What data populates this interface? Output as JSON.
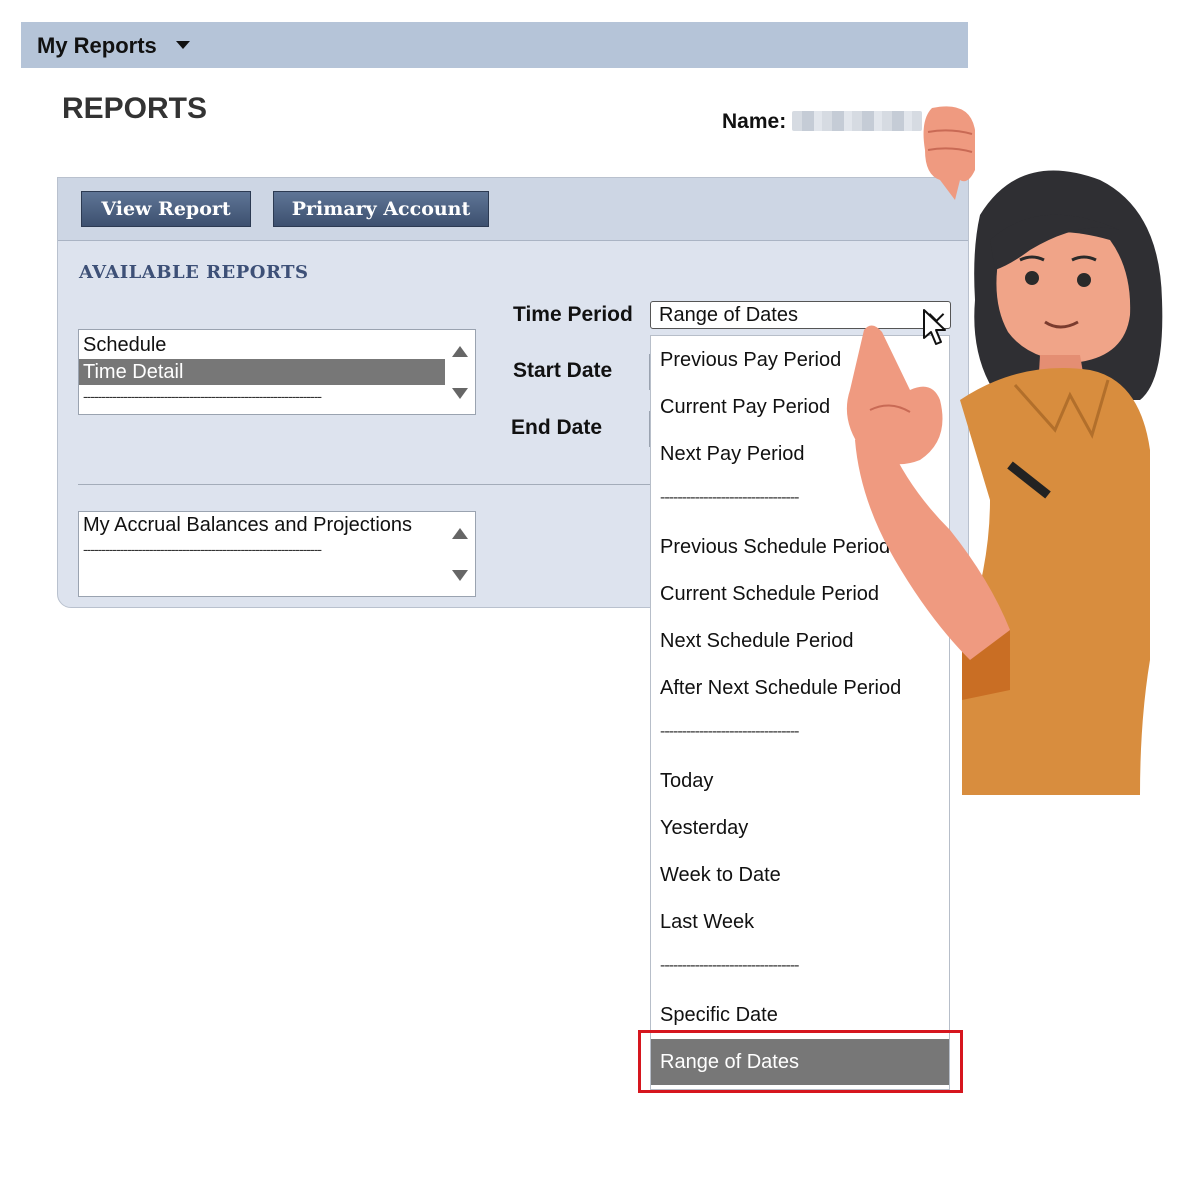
{
  "header": {
    "menu_title": "My Reports"
  },
  "page": {
    "title": "REPORTS",
    "name_label": "Name:"
  },
  "toolbar": {
    "view_report": "View Report",
    "primary_account": "Primary Account"
  },
  "reports": {
    "section_label": "AVAILABLE REPORTS",
    "list1": {
      "items": [
        "Schedule",
        "Time Detail"
      ],
      "selected": "Time Detail",
      "separator": "-----------------------------------------------------------------"
    },
    "list2": {
      "items": [
        "My Accrual Balances and Projections"
      ],
      "separator": "-----------------------------------------------------------------"
    }
  },
  "filters": {
    "time_period_label": "Time Period",
    "time_period_value": "Range of Dates",
    "start_date_label": "Start Date",
    "end_date_label": "End Date"
  },
  "dropdown": {
    "separator": "--------------------------------",
    "options": [
      "Previous Pay Period",
      "Current Pay Period",
      "Next Pay Period",
      "Previous Schedule Period",
      "Current Schedule Period",
      "Next Schedule Period",
      "After Next Schedule Period",
      "Today",
      "Yesterday",
      "Week to Date",
      "Last Week",
      "Specific Date",
      "Range of Dates"
    ],
    "selected": "Range of Dates"
  },
  "colors": {
    "topbar": "#b5c4d8",
    "panel": "#dde3ee",
    "button": "#4a5e80",
    "section_label": "#3d5077",
    "selected_option": "#777777",
    "highlight_box": "#d6161e"
  },
  "icons": [
    "chevron-down-icon",
    "scroll-up-icon",
    "scroll-down-icon",
    "mouse-pointer-icon"
  ]
}
